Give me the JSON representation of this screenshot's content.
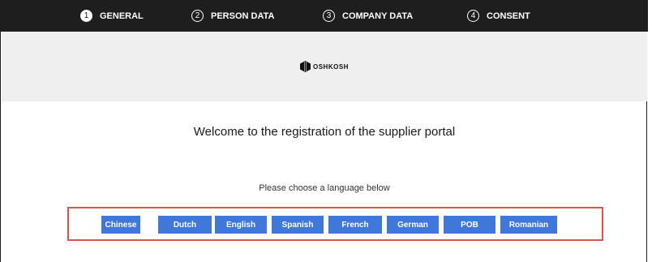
{
  "steps": [
    {
      "number": "1",
      "label": "GENERAL",
      "active": true
    },
    {
      "number": "2",
      "label": "PERSON DATA",
      "active": false
    },
    {
      "number": "3",
      "label": "COMPANY DATA",
      "active": false
    },
    {
      "number": "4",
      "label": "CONSENT",
      "active": false
    }
  ],
  "logo": {
    "text": "OSHKOSH",
    "icon": "oshkosh-logo-icon"
  },
  "welcome_text": "Welcome to the registration of the supplier portal",
  "language_prompt": "Please choose a language below",
  "languages": [
    "Chinese",
    "Dutch",
    "English",
    "Spanish",
    "French",
    "German",
    "POB",
    "Romanian"
  ],
  "colors": {
    "stepbar_bg": "#1e1e1e",
    "logo_band_bg": "#efefef",
    "button_bg": "#3f78d9",
    "highlight_border": "#d9534f"
  }
}
